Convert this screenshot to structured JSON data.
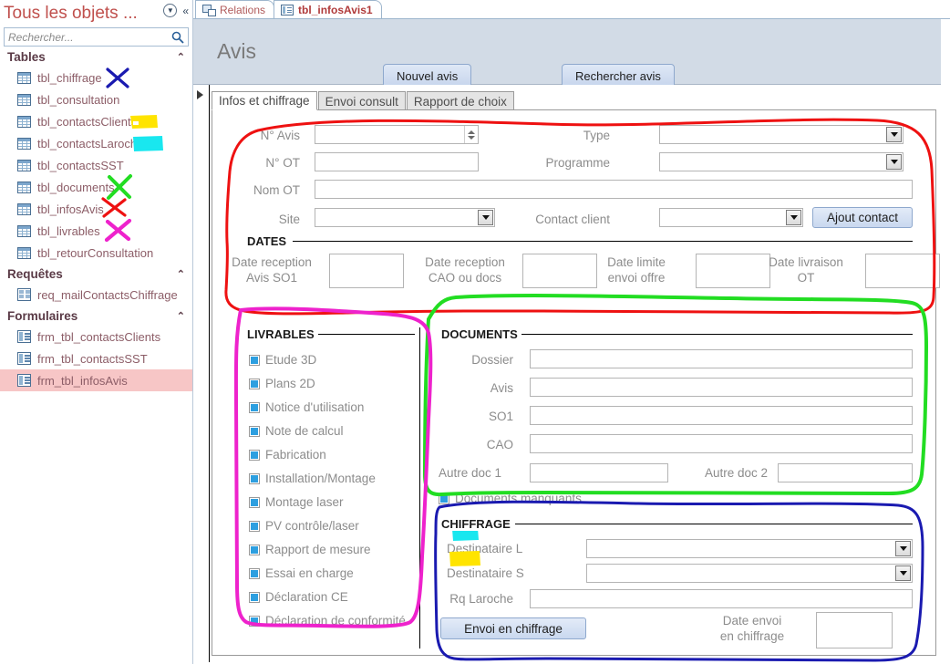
{
  "navpane": {
    "title": "Tous les objets ...",
    "dropdown_icon": "circle-chevron-down-icon",
    "collapse_icon": "double-chevron-left-icon",
    "search": {
      "placeholder": "Rechercher...",
      "value": "",
      "icon": "search-icon"
    },
    "groups": [
      {
        "name": "Tables",
        "collapse_icon": "chevron-up-icon",
        "items": [
          {
            "label": "tbl_chiffrage",
            "icon": "table-icon",
            "selected": false,
            "mark": "blue-x"
          },
          {
            "label": "tbl_consultation",
            "icon": "table-icon",
            "selected": false,
            "mark": ""
          },
          {
            "label": "tbl_contactsClients",
            "icon": "table-icon",
            "selected": false,
            "mark": "yellow-highlight"
          },
          {
            "label": "tbl_contactsLaroche",
            "icon": "table-icon",
            "selected": false,
            "mark": "cyan-highlight"
          },
          {
            "label": "tbl_contactsSST",
            "icon": "table-icon",
            "selected": false,
            "mark": ""
          },
          {
            "label": "tbl_documents",
            "icon": "table-icon",
            "selected": false,
            "mark": "green-x"
          },
          {
            "label": "tbl_infosAvis",
            "icon": "table-icon",
            "selected": false,
            "mark": "red-x"
          },
          {
            "label": "tbl_livrables",
            "icon": "table-icon",
            "selected": false,
            "mark": "magenta-x"
          },
          {
            "label": "tbl_retourConsultation",
            "icon": "table-icon",
            "selected": false,
            "mark": ""
          }
        ]
      },
      {
        "name": "Requêtes",
        "collapse_icon": "chevron-up-icon",
        "items": [
          {
            "label": "req_mailContactsChiffrage",
            "icon": "query-icon",
            "selected": false,
            "mark": ""
          }
        ]
      },
      {
        "name": "Formulaires",
        "collapse_icon": "chevron-up-icon",
        "items": [
          {
            "label": "frm_tbl_contactsClients",
            "icon": "form-icon",
            "selected": false,
            "mark": ""
          },
          {
            "label": "frm_tbl_contactsSST",
            "icon": "form-icon",
            "selected": false,
            "mark": ""
          },
          {
            "label": "frm_tbl_infosAvis",
            "icon": "form-icon",
            "selected": true,
            "mark": ""
          }
        ]
      }
    ]
  },
  "doc_tabs": [
    {
      "label": "Relations",
      "icon": "relations-icon",
      "active": false
    },
    {
      "label": "tbl_infosAvis1",
      "icon": "form-icon",
      "active": true
    }
  ],
  "form_header": {
    "title": "Avis",
    "buttons": [
      {
        "label": "Nouvel avis",
        "name": "nouvel-avis-button"
      },
      {
        "label": "Rechercher avis",
        "name": "rechercher-avis-button"
      }
    ]
  },
  "control_tabs": [
    {
      "label": "Infos et chiffrage",
      "active": true
    },
    {
      "label": "Envoi consult",
      "active": false
    },
    {
      "label": "Rapport de choix",
      "active": false
    }
  ],
  "top_fields": {
    "n_avis": {
      "label": "N° Avis",
      "value": "",
      "type": "spinner"
    },
    "n_ot": {
      "label": "N° OT",
      "value": "",
      "type": "text"
    },
    "nom_ot": {
      "label": "Nom OT",
      "value": "",
      "type": "text"
    },
    "site": {
      "label": "Site",
      "value": "",
      "type": "combo"
    },
    "type": {
      "label": "Type",
      "value": "",
      "type": "combo"
    },
    "programme": {
      "label": "Programme",
      "value": "",
      "type": "combo"
    },
    "contact_client": {
      "label": "Contact client",
      "value": "",
      "type": "combo"
    },
    "ajout_contact_button": {
      "label": "Ajout contact"
    }
  },
  "dates": {
    "section_title": "DATES",
    "fields": [
      {
        "label_line1": "Date reception",
        "label_line2": "Avis SO1",
        "value": ""
      },
      {
        "label_line1": "Date reception",
        "label_line2": "CAO ou docs",
        "value": ""
      },
      {
        "label_line1": "Date limite",
        "label_line2": "envoi offre",
        "value": ""
      },
      {
        "label_line1": "Date livraison",
        "label_line2": "OT",
        "value": ""
      }
    ]
  },
  "livrables": {
    "section_title": "LIVRABLES",
    "items": [
      {
        "label": "Etude 3D",
        "state": "null"
      },
      {
        "label": "Plans 2D",
        "state": "null"
      },
      {
        "label": "Notice d'utilisation",
        "state": "null"
      },
      {
        "label": "Note de calcul",
        "state": "null"
      },
      {
        "label": "Fabrication",
        "state": "null"
      },
      {
        "label": "Installation/Montage",
        "state": "null"
      },
      {
        "label": "Montage laser",
        "state": "null"
      },
      {
        "label": "PV contrôle/laser",
        "state": "null"
      },
      {
        "label": "Rapport de mesure",
        "state": "null"
      },
      {
        "label": "Essai en charge",
        "state": "null"
      },
      {
        "label": "Déclaration CE",
        "state": "null"
      },
      {
        "label": "Déclaration de conformité",
        "state": "null"
      }
    ]
  },
  "documents": {
    "section_title": "DOCUMENTS",
    "fields": [
      {
        "label": "Dossier",
        "value": ""
      },
      {
        "label": "Avis",
        "value": ""
      },
      {
        "label": "SO1",
        "value": ""
      },
      {
        "label": "CAO",
        "value": ""
      }
    ],
    "autre_doc_1": {
      "label": "Autre doc 1",
      "value": ""
    },
    "autre_doc_2": {
      "label": "Autre doc 2",
      "value": ""
    },
    "manquants": {
      "label": "Documents manquants",
      "state": "null"
    }
  },
  "chiffrage": {
    "section_title": "CHIFFRAGE",
    "destinataire_laroche": {
      "label": "Destinataire L",
      "value": "",
      "mark": "cyan-highlight"
    },
    "destinataire_sst": {
      "label": "Destinataire S",
      "value": "",
      "mark": "yellow-highlight"
    },
    "rq_laroche": {
      "label": "Rq Laroche",
      "value": ""
    },
    "envoi_button": {
      "label": "Envoi en chiffrage"
    },
    "date_envoi": {
      "label_line1": "Date envoi",
      "label_line2": "en chiffrage",
      "value": ""
    }
  },
  "annotation_colors": {
    "red": "#ee1111",
    "green": "#22dd22",
    "magenta": "#ee22cc",
    "blue": "#1a1ab0",
    "yellow": "#ffe400",
    "cyan": "#19e7ef"
  }
}
